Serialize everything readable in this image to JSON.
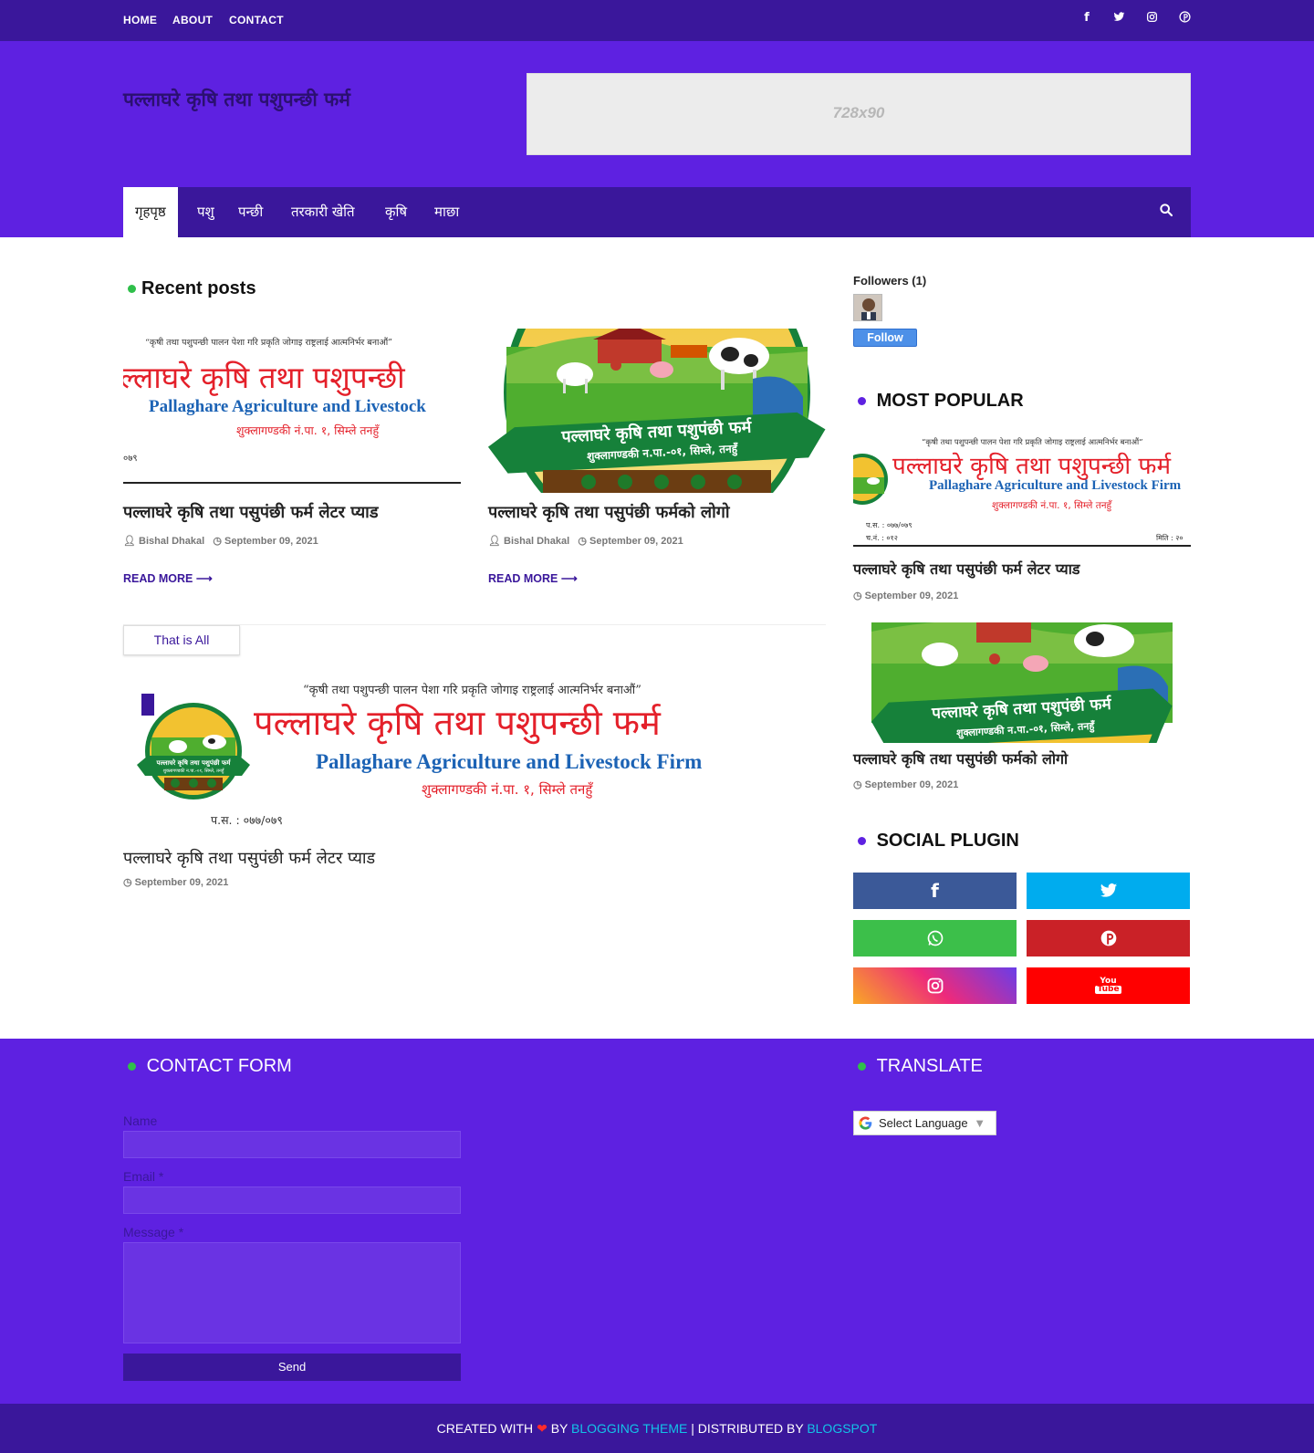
{
  "topnav": {
    "home": "HOME",
    "about": "ABOUT",
    "contact": "CONTACT"
  },
  "top_social_icons": [
    "facebook-icon",
    "twitter-icon",
    "instagram-icon",
    "pinterest-icon"
  ],
  "site": {
    "title": "पल्लाघरे कृषि तथा पशुपन्छी फर्म"
  },
  "ad": {
    "text": "728x90"
  },
  "mainnav": [
    "गृहपृष्ठ",
    "पशु",
    "पन्छी",
    "तरकारी खेति",
    "कृषि",
    "माछा"
  ],
  "recent": {
    "heading": "Recent posts",
    "posts": [
      {
        "title": "पल्लाघरे कृषि तथा पसुपंछी फर्म लेटर प्याड",
        "author": "Bishal Dhakal",
        "date": "September 09, 2021",
        "read_more": "READ MORE"
      },
      {
        "title": "पल्लाघरे कृषि तथा पसुपंछी फर्मको लोगो",
        "author": "Bishal Dhakal",
        "date": "September 09, 2021",
        "read_more": "READ MORE"
      }
    ],
    "that_is_all": "That is All"
  },
  "letterhead": {
    "motto": "“कृषी तथा पशुपन्छी पालन पेशा गरि प्रकृति जोगाइ राष्ट्रलाई आत्मनिर्भर बनाऔं”",
    "name_np": "पल्लाघरे कृषि तथा पशुपन्छी फर्म",
    "name_en": "Pallaghare Agriculture and Livestock Firm",
    "address": "शुक्लागण्डकी नं.पा. १, सिम्ले तनहुँ",
    "ps": "प.स. : ०७७/०७९",
    "cha": "च.नं. : ०१२",
    "miti": "मिति : २०",
    "logo_ribbon": "पल्लाघरे कृषि तथा पशुपंछी फर्म",
    "logo_sub": "शुक्लागण्डकी न.पा.-०१, सिम्ले, तनहुँ",
    "logo_small_ribbon": "पल्लाघरे कृषि तथा पशुपंछी फर्म",
    "logo_small_sub": "शुक्लागण्डकी न.पा.-०१, सिम्ले, तनहुँ",
    "ps_short": "०७९",
    "name_np_partial": "ल्लाघरे कृषि तथा पशुपन्छी",
    "name_en_partial": "Pallaghare Agriculture and Livestock"
  },
  "featured": {
    "title": "पल्लाघरे कृषि तथा पसुपंछी फर्म लेटर प्याड",
    "date": "September 09, 2021"
  },
  "sidebar": {
    "followers_title": "Followers (1)",
    "follow_label": "Follow",
    "popular_heading": "MOST POPULAR",
    "popular": [
      {
        "title": "पल्लाघरे कृषि तथा पसुपंछी फर्म लेटर प्याड",
        "date": "September 09, 2021"
      },
      {
        "title": "पल्लाघरे कृषि तथा पसुपंछी फर्मको लोगो",
        "date": "September 09, 2021"
      }
    ],
    "social_heading": "SOCIAL PLUGIN",
    "social_icons": [
      "facebook-icon",
      "twitter-icon",
      "whatsapp-icon",
      "pinterest-icon",
      "instagram-icon",
      "youtube-icon"
    ],
    "youtube_label_top": "You",
    "youtube_label_bottom": "Tube"
  },
  "contact_form": {
    "heading": "CONTACT FORM",
    "name_label": "Name",
    "email_label": "Email",
    "message_label": "Message",
    "required_mark": "*",
    "send_label": "Send"
  },
  "translate": {
    "heading": "TRANSLATE",
    "select_label": "Select Language",
    "arrow": "▼"
  },
  "footer": {
    "created_with": "CREATED WITH",
    "by": "BY",
    "theme": "BLOGGING THEME",
    "sep": "| DISTRIBUTED BY",
    "blogspot": "BLOGSPOT"
  },
  "colors": {
    "top_bar": "#3a179b",
    "header": "#5e21e1",
    "accent_dot_green": "#2fbf4a",
    "accent_dot_purple": "#5e21e1",
    "facebook": "#3b5998",
    "twitter": "#00acee",
    "whatsapp": "#3cbf4a",
    "pinterest": "#ca2127",
    "youtube": "#ff0000",
    "letter_red": "#e4202a",
    "letter_blue": "#1c63b5"
  }
}
